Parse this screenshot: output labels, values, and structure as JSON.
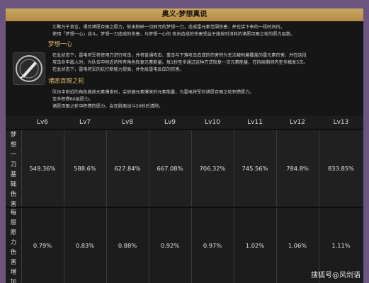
{
  "title": "奥义·梦想真说",
  "desc_lines": [
    "汇聚万千真言，竭尽诸愿百眼之愿力，斩出粉碎一切邪咒的梦想一刀，造成雷元素范围伤害；并在接下来的一段时间内，",
    "使用「梦想一心」战斗。梦想一刀造成的伤害，与梦想一心的 攻击造成的伤害受益于施放时消耗的诸愿百眼之轮的愿力层数。"
  ],
  "section1": {
    "title": "梦想一心",
    "lines": [
      "在此状态下，雷电将军将使用刀进行攻击，并将普通攻击、重击与下落攻击造成的伤害转为无法被附魔覆盖的雷元素伤害。并在这段",
      "攻击命中敌人时，为队伍中附近的所有角色恢复元素能量。每1秒至多通过这种方式恢复一次元素能量，在持续期间内至多触发5次。",
      "在此状态下，雷电将军的抗打断能力提高，并免疫雷电反应的伤害。"
    ]
  },
  "section2": {
    "title": "诸愿百眼之轮",
    "lines": [
      "队伍中附近的角色施放元素爆发时，会依据元素爆发的元素能量，为雷电将军的诸愿百眼之轮积攒愿力。",
      "至多积攒60层愿力。",
      "诸愿百眼之轮中积攒的愿力，会在脱离战斗30秒后清除。"
    ]
  },
  "table": {
    "levels": [
      "Lv6",
      "Lv7",
      "Lv8",
      "Lv9",
      "Lv10",
      "Lv11",
      "Lv12",
      "Lv13"
    ],
    "row1_label": [
      "梦",
      "想",
      "一",
      "刀",
      "基",
      "础",
      "伤",
      "害"
    ],
    "row1_values": [
      "549.36%",
      "588.6%",
      "627.84%",
      "667.08%",
      "706.32%",
      "745.56%",
      "784.8%",
      "833.85%"
    ],
    "row2_label": [
      "每",
      "层",
      "愿",
      "力",
      "伤",
      "害",
      "增",
      "加"
    ],
    "row2_values": [
      "0.79%",
      "0.83%",
      "0.88%",
      "0.92%",
      "0.97%",
      "1.02%",
      "1.06%",
      "1.11%"
    ]
  },
  "watermark": "搜狐号@风剑语"
}
